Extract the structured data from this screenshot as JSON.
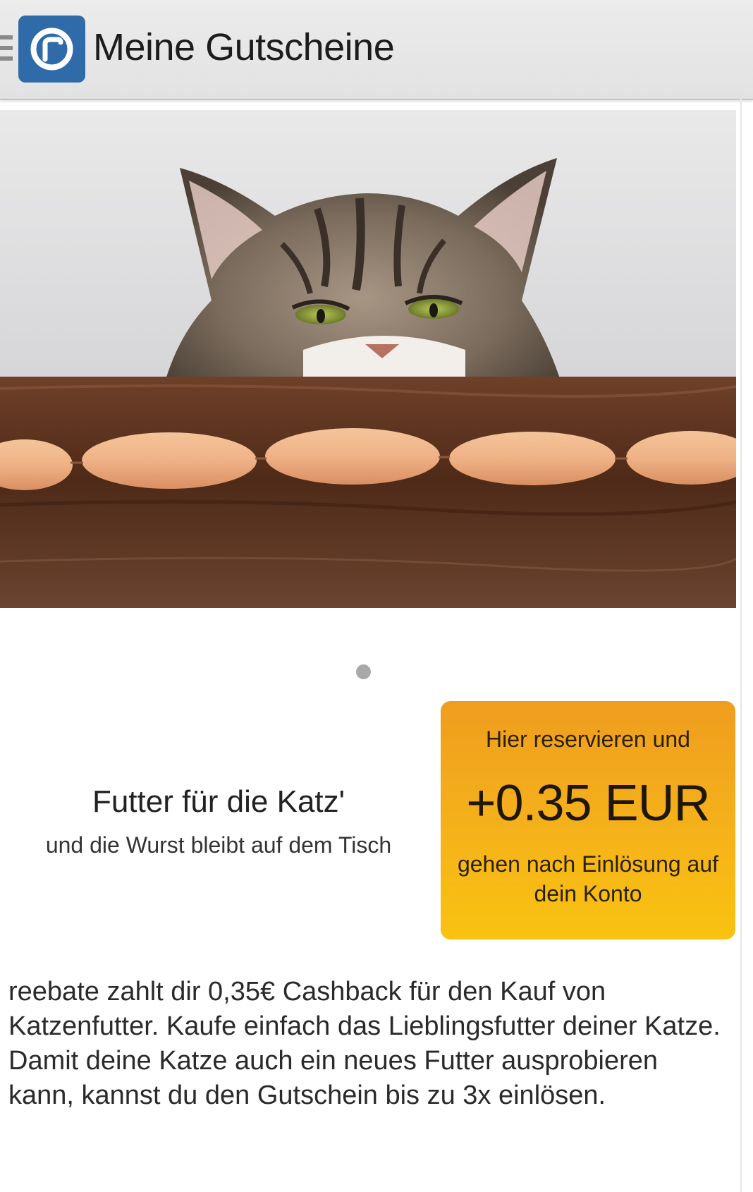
{
  "header": {
    "menu_icon": "hamburger-menu-icon",
    "logo_icon": "reebate-logo-icon",
    "title": "Meine Gutscheine"
  },
  "hero": {
    "image": "cat-peeking-over-table-with-sausages",
    "slide_count": 1,
    "active_slide": 1
  },
  "offer": {
    "title": "Futter für die Katz'",
    "subtitle": "und die Wurst bleibt auf dem Tisch"
  },
  "cashback_button": {
    "top_text": "Hier reservieren und",
    "amount": "+0.35 EUR",
    "bottom_text": "gehen nach Einlösung auf dein Konto",
    "gradient_top": "#ef9d1e",
    "gradient_bottom": "#f9c310"
  },
  "description": "reebate zahlt dir 0,35€ Cashback für den Kauf von Katzenfutter. Kaufe einfach das Lieblingsfutter deiner Katze. Damit deine Katze auch ein neues Futter ausprobieren kann, kannst du den Gutschein bis zu 3x einlösen.",
  "colors": {
    "brand_blue": "#2f6ba8",
    "appbar": "#e6e6e6"
  }
}
